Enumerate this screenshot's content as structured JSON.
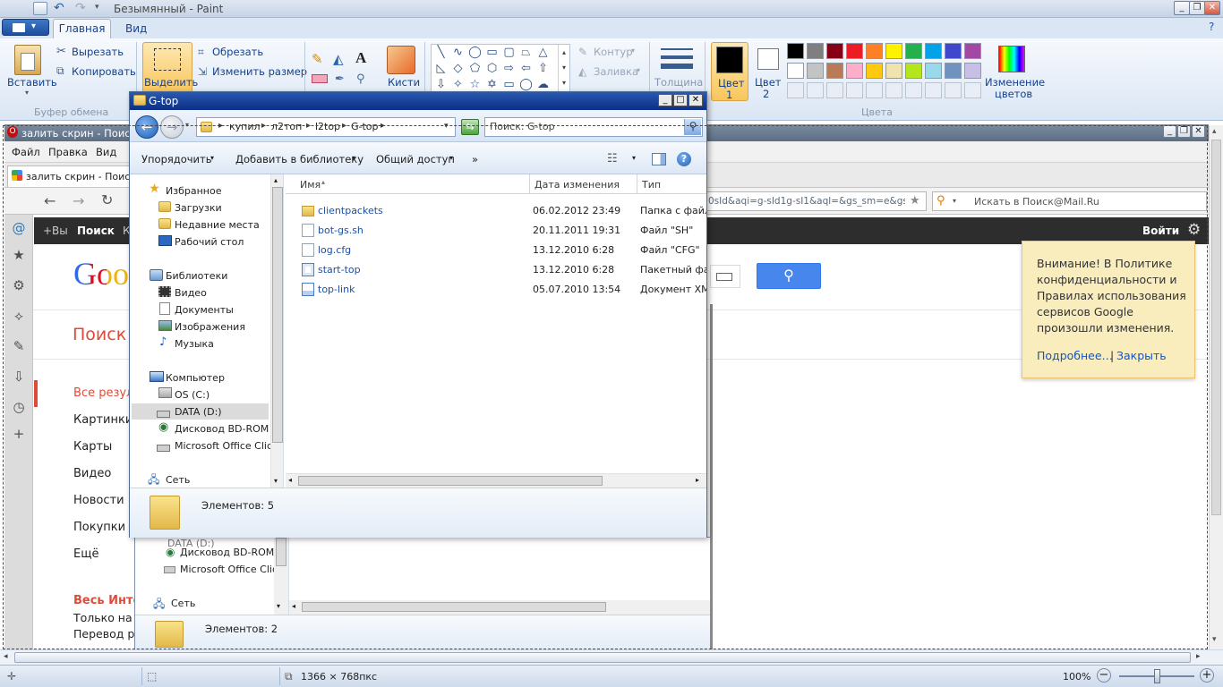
{
  "paint": {
    "title": "Безымянный - Paint",
    "tabs": {
      "home": "Главная",
      "view": "Вид"
    },
    "clipboard": {
      "paste": "Вставить",
      "cut": "Вырезать",
      "copy": "Копировать",
      "group": "Буфер обмена"
    },
    "image": {
      "select": "Выделить",
      "crop": "Обрезать",
      "resize": "Изменить размер"
    },
    "tools": {
      "brushes": "Кисти"
    },
    "shapes": {
      "outline": "Контур",
      "fill": "Заливка"
    },
    "size": {
      "label": "Толщина"
    },
    "colors": {
      "color1_a": "Цвет",
      "color1_b": "1",
      "color2_a": "Цвет",
      "color2_b": "2",
      "edit_a": "Изменение",
      "edit_b": "цветов",
      "group": "Цвета"
    },
    "palette_row1": [
      "#000000",
      "#7f7f7f",
      "#880015",
      "#ed1c24",
      "#ff7f27",
      "#fff200",
      "#22b14c",
      "#00a2e8",
      "#3f48cc",
      "#a349a4"
    ],
    "palette_row2": [
      "#ffffff",
      "#c3c3c3",
      "#b97a57",
      "#ffaec9",
      "#ffc90e",
      "#efe4b0",
      "#b5e61d",
      "#99d9ea",
      "#7092be",
      "#c8bfe7"
    ],
    "status": {
      "size": "1366 × 768пкс",
      "zoom": "100%"
    }
  },
  "browser": {
    "title": "залить скрин - Поиск",
    "menu": {
      "file": "Файл",
      "edit": "Правка",
      "view": "Вид"
    },
    "tab_title": "залить скрин - Поиск в",
    "address_tail": "0sId&aqi=g-sId1g-sI1&aql=&gs_sm=e&gs_up",
    "search_placeholder": "Искать в Поиск@Mail.Ru",
    "gbar": {
      "plus": "+Вы",
      "search": "Поиск",
      "k": "К",
      "login": "Войти"
    },
    "logo": "Goo",
    "poisk": "Поиск",
    "left_nav": [
      "Все резул",
      "Картинки",
      "Карты",
      "Видео",
      "Новости",
      "Покупки",
      "Ещё"
    ],
    "bottom": {
      "web": "Весь Инте",
      "only": "Только на р",
      "translate": "Перевод р"
    },
    "popup": {
      "text": "Внимание! В Политике конфиденциальности и Правилах использования сервисов Google произошли изменения.",
      "more": "Подробнее…",
      "sep": "|",
      "close": "Закрыть"
    }
  },
  "explorer": {
    "title": "G-top",
    "path": [
      "купил",
      "л2топ",
      "l2top",
      "G-top"
    ],
    "search_placeholder": "Поиск: G-top",
    "toolbar": {
      "organize": "Упорядочить",
      "add_library": "Добавить в библиотеку",
      "share": "Общий доступ",
      "more": "»"
    },
    "nav": {
      "favorites": "Избранное",
      "downloads": "Загрузки",
      "recent": "Недавние места",
      "desktop": "Рабочий стол",
      "libraries": "Библиотеки",
      "video": "Видео",
      "documents": "Документы",
      "images": "Изображения",
      "music": "Музыка",
      "computer": "Компьютер",
      "os_c": "OS (C:)",
      "data_d": "DATA (D:)",
      "bd_rom": "Дисковод BD-ROM (F",
      "office": "Microsoft Office Click-",
      "network": "Сеть"
    },
    "columns": {
      "name": "Имя",
      "date": "Дата изменения",
      "type": "Тип"
    },
    "files": [
      {
        "name": "clientpackets",
        "date": "06.02.2012 23:49",
        "type": "Папка с файла",
        "icon": "folder-icon"
      },
      {
        "name": "bot-gs.sh",
        "date": "20.11.2011 19:31",
        "type": "Файл \"SH\"",
        "icon": "file-icon"
      },
      {
        "name": "log.cfg",
        "date": "13.12.2010 6:28",
        "type": "Файл \"CFG\"",
        "icon": "file-icon"
      },
      {
        "name": "start-top",
        "date": "13.12.2010 6:28",
        "type": "Пакетный фай",
        "icon": "batch-icon"
      },
      {
        "name": "top-link",
        "date": "05.07.2010 13:54",
        "type": "Документ XML",
        "icon": "xml-icon"
      }
    ],
    "status": "Элементов: 5"
  },
  "explorer2": {
    "nav": {
      "bd_rom": "Дисковод BD-ROM (F",
      "office": "Microsoft Office Click-",
      "network": "Сеть"
    },
    "status": "Элементов: 2"
  }
}
